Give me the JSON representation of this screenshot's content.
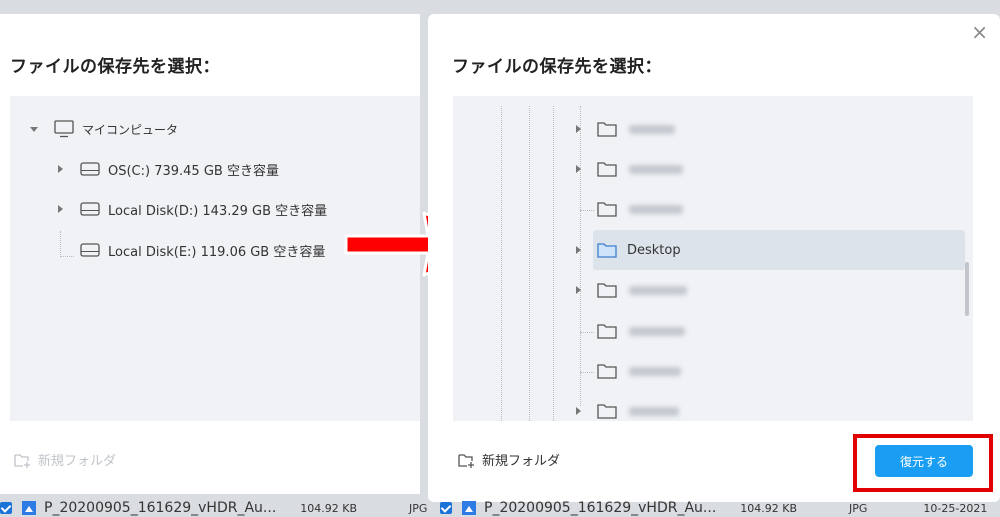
{
  "left": {
    "title": "ファイルの保存先を選択：",
    "tree": {
      "root": "マイコンピュータ",
      "drives": [
        "OS(C:)  739.45 GB 空き容量",
        "Local Disk(D:)  143.29 GB 空き容量",
        "Local Disk(E:)  119.06 GB 空き容量"
      ]
    },
    "new_folder": "新規フォルダ"
  },
  "right": {
    "title": "ファイルの保存先を選択：",
    "close": "×",
    "folders": [
      {
        "label": "",
        "blurred": true,
        "expandable": true
      },
      {
        "label": "",
        "blurred": true,
        "expandable": true
      },
      {
        "label": "",
        "blurred": true,
        "expandable": false
      },
      {
        "label": "Desktop",
        "blurred": false,
        "expandable": true,
        "selected": true
      },
      {
        "label": "",
        "blurred": true,
        "expandable": true
      },
      {
        "label": "",
        "blurred": true,
        "expandable": false
      },
      {
        "label": "",
        "blurred": true,
        "expandable": false
      },
      {
        "label": "",
        "blurred": true,
        "expandable": true
      }
    ],
    "new_folder": "新規フォルダ",
    "restore_button": "復元する"
  },
  "file_rows": [
    {
      "name": "P_20200905_161629_vHDR_Au...",
      "size": "104.92 KB",
      "type": "JPG",
      "date": ""
    },
    {
      "name": "P_20200905_161629_vHDR_Au...",
      "size": "104.92 KB",
      "type": "JPG",
      "date": "10-25-2021"
    }
  ],
  "colors": {
    "accent": "#1a9ef3",
    "highlight": "#e00000",
    "selected_row": "#dde3ea",
    "folder_selected": "#cfe3fa"
  }
}
